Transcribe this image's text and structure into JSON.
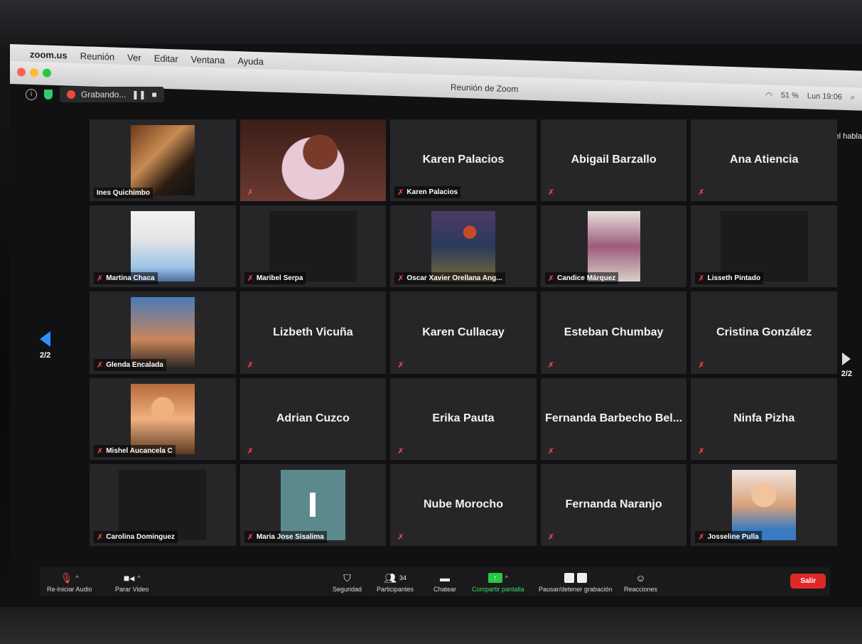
{
  "menubar": {
    "app": "zoom.us",
    "items": [
      "Reunión",
      "Ver",
      "Editar",
      "Ventana",
      "Ayuda"
    ]
  },
  "window": {
    "title": "Reunión de Zoom",
    "battery": "51 %",
    "clock": "Lun 19:06"
  },
  "top": {
    "recording_label": "Grabando...",
    "speaker_view": "Vista del habla"
  },
  "pager": {
    "left": "2/2",
    "right": "2/2"
  },
  "participants": [
    {
      "name": "Ines Quichimbo",
      "video": "v1",
      "muted": false,
      "show_center": false
    },
    {
      "name": "",
      "video": "v2",
      "muted": true,
      "show_center": false
    },
    {
      "name": "Karen Palacios",
      "video": "",
      "muted": true,
      "show_center": true,
      "label": "Karen Palacios"
    },
    {
      "name": "Abigail Barzallo",
      "video": "",
      "muted": true,
      "show_center": true,
      "label": ""
    },
    {
      "name": "Ana Atiencia",
      "video": "",
      "muted": true,
      "show_center": true,
      "label": ""
    },
    {
      "name": "Martina Chaca",
      "video": "v3",
      "muted": true,
      "show_center": false
    },
    {
      "name": "Maribel Serpa",
      "video": "dim",
      "muted": true,
      "show_center": false
    },
    {
      "name": "Oscar Xavier Orellana Ang...",
      "video": "v4",
      "muted": true,
      "show_center": false
    },
    {
      "name": "Candice Márquez",
      "video": "v5",
      "muted": true,
      "show_center": false
    },
    {
      "name": "Lisseth Pintado",
      "video": "dim",
      "muted": true,
      "show_center": false
    },
    {
      "name": "Glenda Encalada",
      "video": "v6",
      "muted": true,
      "show_center": false
    },
    {
      "name": "Lizbeth Vicuña",
      "video": "",
      "muted": true,
      "show_center": true,
      "label": ""
    },
    {
      "name": "Karen Cullacay",
      "video": "",
      "muted": true,
      "show_center": true,
      "label": ""
    },
    {
      "name": "Esteban Chumbay",
      "video": "",
      "muted": true,
      "show_center": true,
      "label": ""
    },
    {
      "name": "Cristina González",
      "video": "",
      "muted": true,
      "show_center": true,
      "label": ""
    },
    {
      "name": "Mishel Aucancela C",
      "video": "v7",
      "muted": true,
      "show_center": false
    },
    {
      "name": "Adrian Cuzco",
      "video": "",
      "muted": true,
      "show_center": true,
      "label": ""
    },
    {
      "name": "Erika Pauta",
      "video": "",
      "muted": true,
      "show_center": true,
      "label": ""
    },
    {
      "name": "Fernanda Barbecho Bel...",
      "video": "",
      "muted": true,
      "show_center": true,
      "label": ""
    },
    {
      "name": "Ninfa Pizha",
      "video": "",
      "muted": true,
      "show_center": true,
      "label": ""
    },
    {
      "name": "Carolina Dominguez",
      "video": "dim",
      "muted": true,
      "show_center": false
    },
    {
      "name": "Maria Jose Sisalima",
      "video": "v8",
      "muted": true,
      "show_center": false
    },
    {
      "name": "Nube Morocho",
      "video": "",
      "muted": true,
      "show_center": true,
      "label": ""
    },
    {
      "name": "Fernanda Naranjo",
      "video": "",
      "muted": true,
      "show_center": true,
      "label": ""
    },
    {
      "name": "Josseline Pulla",
      "video": "v9",
      "muted": true,
      "show_center": false
    }
  ],
  "toolbar": {
    "audio": "Re-Iniciar Audio",
    "video": "Parar Video",
    "security": "Seguridad",
    "participants": "Participantes",
    "participants_count": "34",
    "chat": "Chatear",
    "share": "Compartir pantalla",
    "recording": "Pausar/detener grabación",
    "reactions": "Reacciones",
    "leave": "Salir"
  },
  "colors": {
    "tile_bg": "#262628",
    "accent_green": "#28c840",
    "leave_red": "#e02828",
    "pager_blue": "#2f8fff"
  }
}
